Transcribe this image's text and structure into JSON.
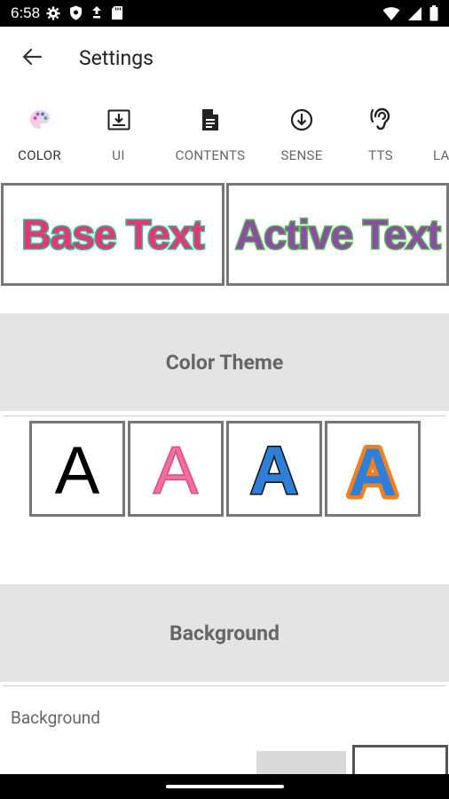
{
  "status_bar": {
    "time": "6:58",
    "left_icons": [
      "gear-icon",
      "shield-icon",
      "data-saver-icon",
      "sd-card-icon"
    ],
    "right_icons": [
      "wifi-icon",
      "signal-icon",
      "battery-icon"
    ]
  },
  "app_bar": {
    "title": "Settings",
    "back_icon": "arrow-back-icon"
  },
  "tabs": [
    {
      "label": "COLOR",
      "icon": "palette-icon",
      "active": true
    },
    {
      "label": "UI",
      "icon": "download-box-icon",
      "active": false
    },
    {
      "label": "CONTENTS",
      "icon": "document-icon",
      "active": false
    },
    {
      "label": "SENSE",
      "icon": "arrow-circle-down-icon",
      "active": false
    },
    {
      "label": "TTS",
      "icon": "hearing-icon",
      "active": false
    },
    {
      "label": "LA",
      "icon": "",
      "active": false
    }
  ],
  "preview": {
    "base_text": "Base Text",
    "active_text": "Active Text",
    "colors": {
      "base_fill": "#e8357a",
      "base_outline": "#2fbf8f",
      "active_fill": "#8b4fa0",
      "active_outline": "#57b85a"
    }
  },
  "color_theme": {
    "header": "Color Theme",
    "options": [
      {
        "letter": "A",
        "fill": "#000000",
        "outline": "none"
      },
      {
        "letter": "A",
        "fill": "#f06fa0",
        "outline": "#d94c85"
      },
      {
        "letter": "A",
        "fill": "#2f7fd8",
        "outline": "#111111"
      },
      {
        "letter": "A",
        "fill": "#2f7fd8",
        "outline": "#f08020"
      }
    ]
  },
  "background": {
    "header": "Background",
    "label": "Background"
  }
}
